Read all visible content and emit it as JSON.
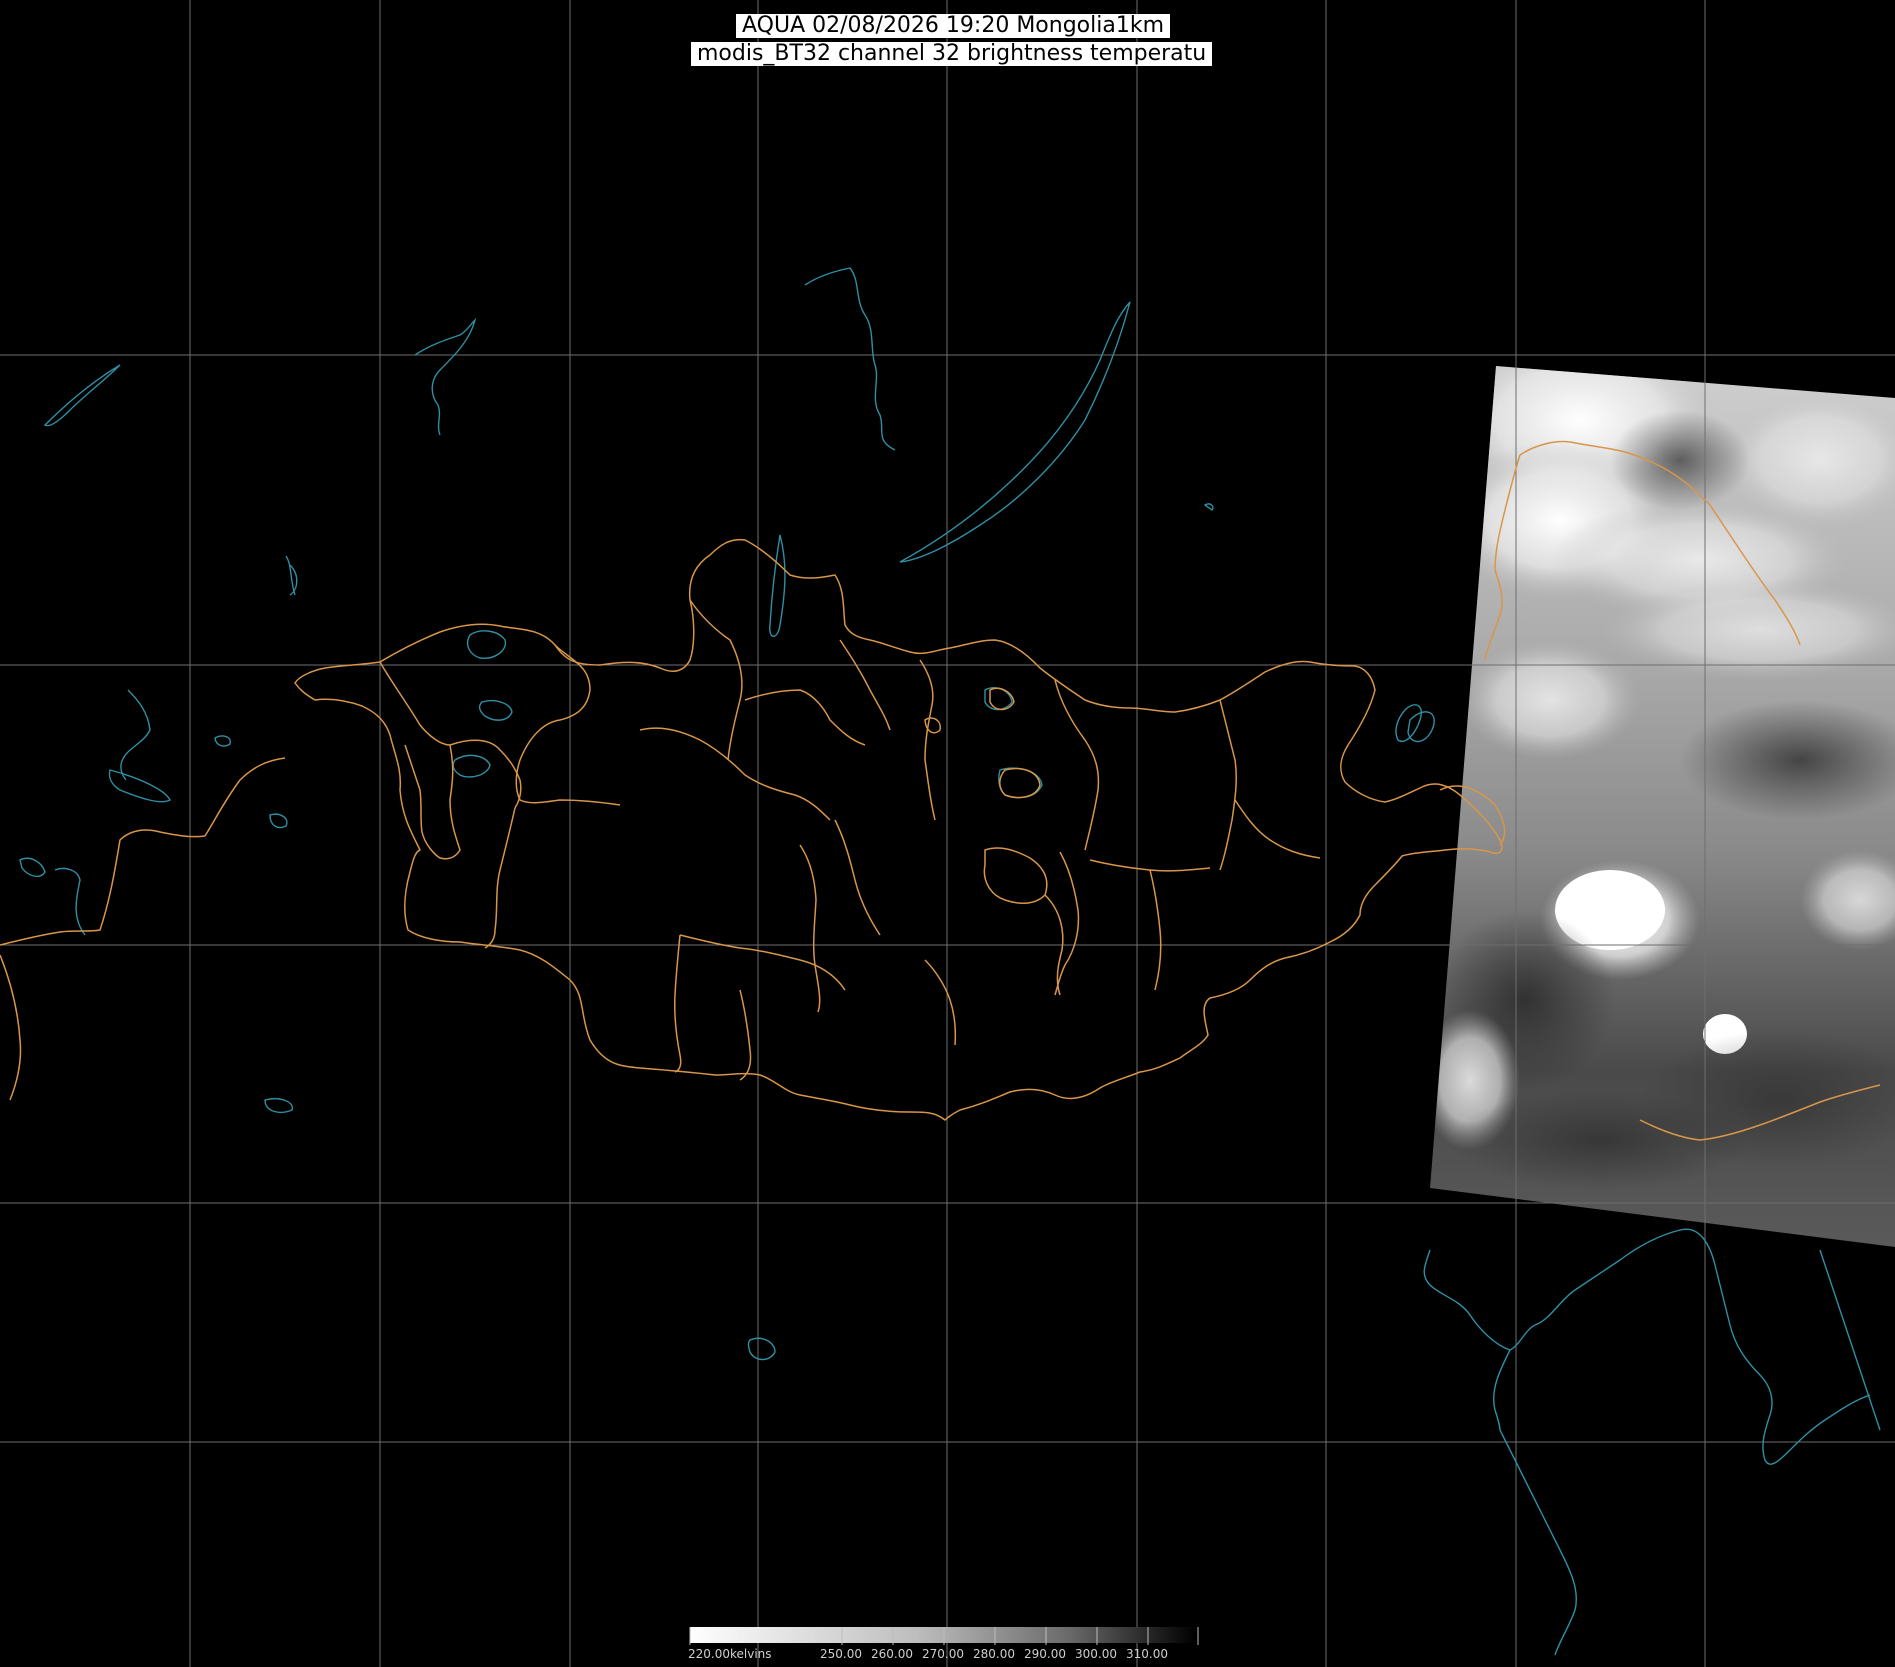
{
  "title": {
    "line1": "AQUA 02/08/2026 19:20 Mongolia1km",
    "line2": "modis_BT32 channel 32 brightness temperatu"
  },
  "legend": {
    "first_label": "220.00kelvins",
    "tick_labels": [
      "250.00",
      "260.00",
      "270.00",
      "280.00",
      "290.00",
      "300.00",
      "310.00"
    ]
  },
  "colors": {
    "background": "#000000",
    "grid": "#6e6e6e",
    "admin_boundary": "#d8964a",
    "water_coast": "#2f8fa3",
    "title_bg": "#ffffff",
    "title_text": "#000000"
  }
}
